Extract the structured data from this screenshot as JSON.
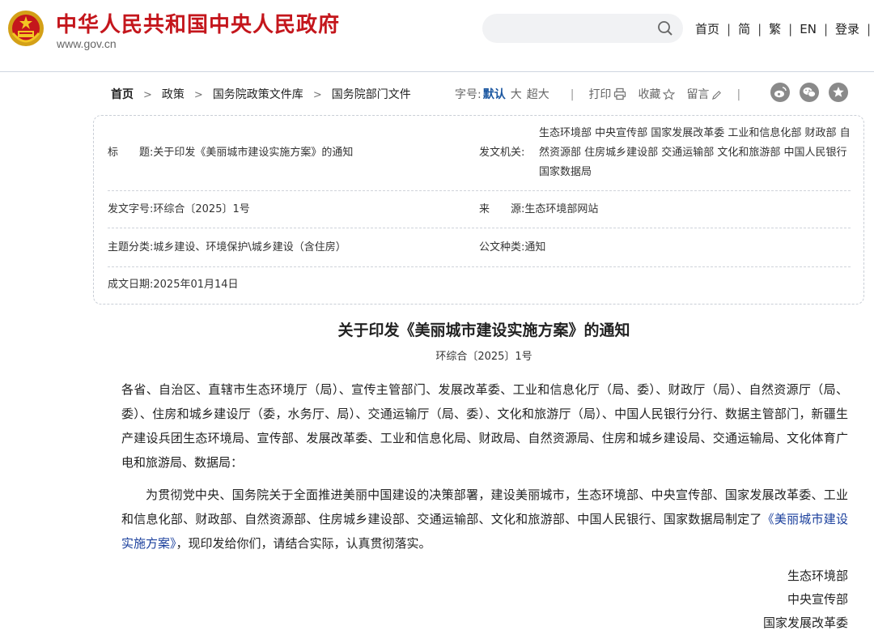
{
  "header": {
    "site_title": "中华人民共和国中央人民政府",
    "site_url": "www.gov.cn",
    "search_placeholder": "",
    "links": [
      "首页",
      "简",
      "繁",
      "EN",
      "登录"
    ]
  },
  "breadcrumb": [
    "首页",
    "政策",
    "国务院政策文件库",
    "国务院部门文件"
  ],
  "toolbar": {
    "font_size_label": "字号:",
    "font_sizes": [
      "默认",
      "大",
      "超大"
    ],
    "print": "打印",
    "favorite": "收藏",
    "comment": "留言"
  },
  "info": {
    "title_key": "标　　题:",
    "title_value": "关于印发《美丽城市建设实施方案》的通知",
    "issuer_key": "发文机关:",
    "issuer_value": "生态环境部 中央宣传部 国家发展改革委 工业和信息化部 财政部 自然资源部 住房城乡建设部 交通运输部 文化和旅游部 中国人民银行 国家数据局",
    "doc_no_key": "发文字号:",
    "doc_no_value": "环综合〔2025〕1号",
    "source_key": "来　　源:",
    "source_value": "生态环境部网站",
    "topic_key": "主题分类:",
    "topic_value": "城乡建设、环境保护\\城乡建设（含住房）",
    "type_key": "公文种类:",
    "type_value": "通知",
    "date_key": "成文日期:",
    "date_value": "2025年01月14日"
  },
  "article": {
    "title": "关于印发《美丽城市建设实施方案》的通知",
    "doc_no": "环综合〔2025〕1号",
    "addressee": "各省、自治区、直辖市生态环境厅（局）、宣传主管部门、发展改革委、工业和信息化厅（局、委）、财政厅（局）、自然资源厅（局、委）、住房和城乡建设厅（委，水务厅、局）、交通运输厅（局、委）、文化和旅游厅（局）、中国人民银行分行、数据主管部门，新疆生产建设兵团生态环境局、宣传部、发展改革委、工业和信息化局、财政局、自然资源局、住房和城乡建设局、交通运输局、文化体育广电和旅游局、数据局：",
    "para_lead": "为贯彻党中央、国务院关于全面推进美丽中国建设的决策部署，建设美丽城市，生态环境部、中央宣传部、国家发展改革委、工业和信息化部、财政部、自然资源部、住房城乡建设部、交通运输部、文化和旅游部、中国人民银行、国家数据局制定了",
    "para_link": "《美丽城市建设实施方案》",
    "para_tail": "，现印发给你们，请结合实际，认真贯彻落实。",
    "signatories": [
      "生态环境部",
      "中央宣传部",
      "国家发展改革委"
    ]
  },
  "colors": {
    "brand_red": "#c4161c",
    "link_blue": "#1a3f9c",
    "active_blue": "#1a56a0"
  },
  "icons": [
    "national-emblem-icon",
    "search-icon",
    "printer-icon",
    "star-icon",
    "pencil-icon",
    "weibo-icon",
    "wechat-icon",
    "favorite-star-icon"
  ]
}
